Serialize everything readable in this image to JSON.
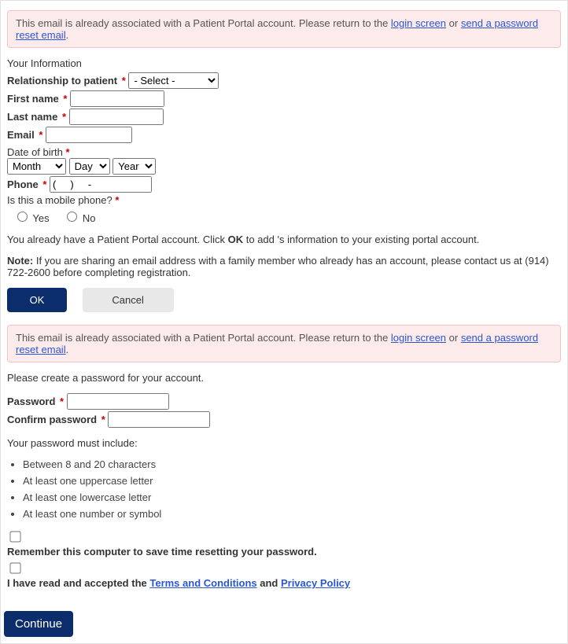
{
  "alert": {
    "prefix": "This email is already associated with a Patient Portal account. Please return to the ",
    "link_login": "login screen",
    "middle": " or ",
    "link_reset": "send a password reset email",
    "suffix": "."
  },
  "section1_title": "Your Information",
  "fields": {
    "relationship": {
      "label": "Relationship to patient",
      "selected": "- Select -"
    },
    "first_name": {
      "label": "First name",
      "value": ""
    },
    "last_name": {
      "label": "Last name",
      "value": ""
    },
    "email": {
      "label": "Email",
      "value": ""
    },
    "dob": {
      "label": "Date of birth",
      "month": "Month",
      "day": "Day",
      "year": "Year"
    },
    "phone": {
      "label": "Phone",
      "value": "(     )     -"
    },
    "mobile_q": "Is this a mobile phone?",
    "yes": "Yes",
    "no": "No"
  },
  "existing": {
    "text_a": "You already have a Patient Portal account. Click ",
    "ok_bold": "OK",
    "text_b": " to add 's information to your existing portal account."
  },
  "note": {
    "label": "Note:",
    "text": " If you are sharing an email address with a family member who already has an account, please contact us at (914) 722-2600 before completing registration."
  },
  "buttons": {
    "ok": "OK",
    "cancel": "Cancel",
    "continue": "Continue"
  },
  "password_section": {
    "intro": "Please create a password for your account.",
    "pwd_label": "Password",
    "cpwd_label": "Confirm password",
    "rules_intro": "Your password must include:",
    "rules": [
      "Between 8 and 20 characters",
      "At least one uppercase letter",
      "At least one lowercase letter",
      "At least one number or symbol"
    ]
  },
  "remember_label": "Remember this computer to save time resetting your password.",
  "terms": {
    "prefix": "I have read and accepted the ",
    "link_terms": "Terms and Conditions",
    "middle": " and ",
    "link_privacy": "Privacy Policy"
  }
}
